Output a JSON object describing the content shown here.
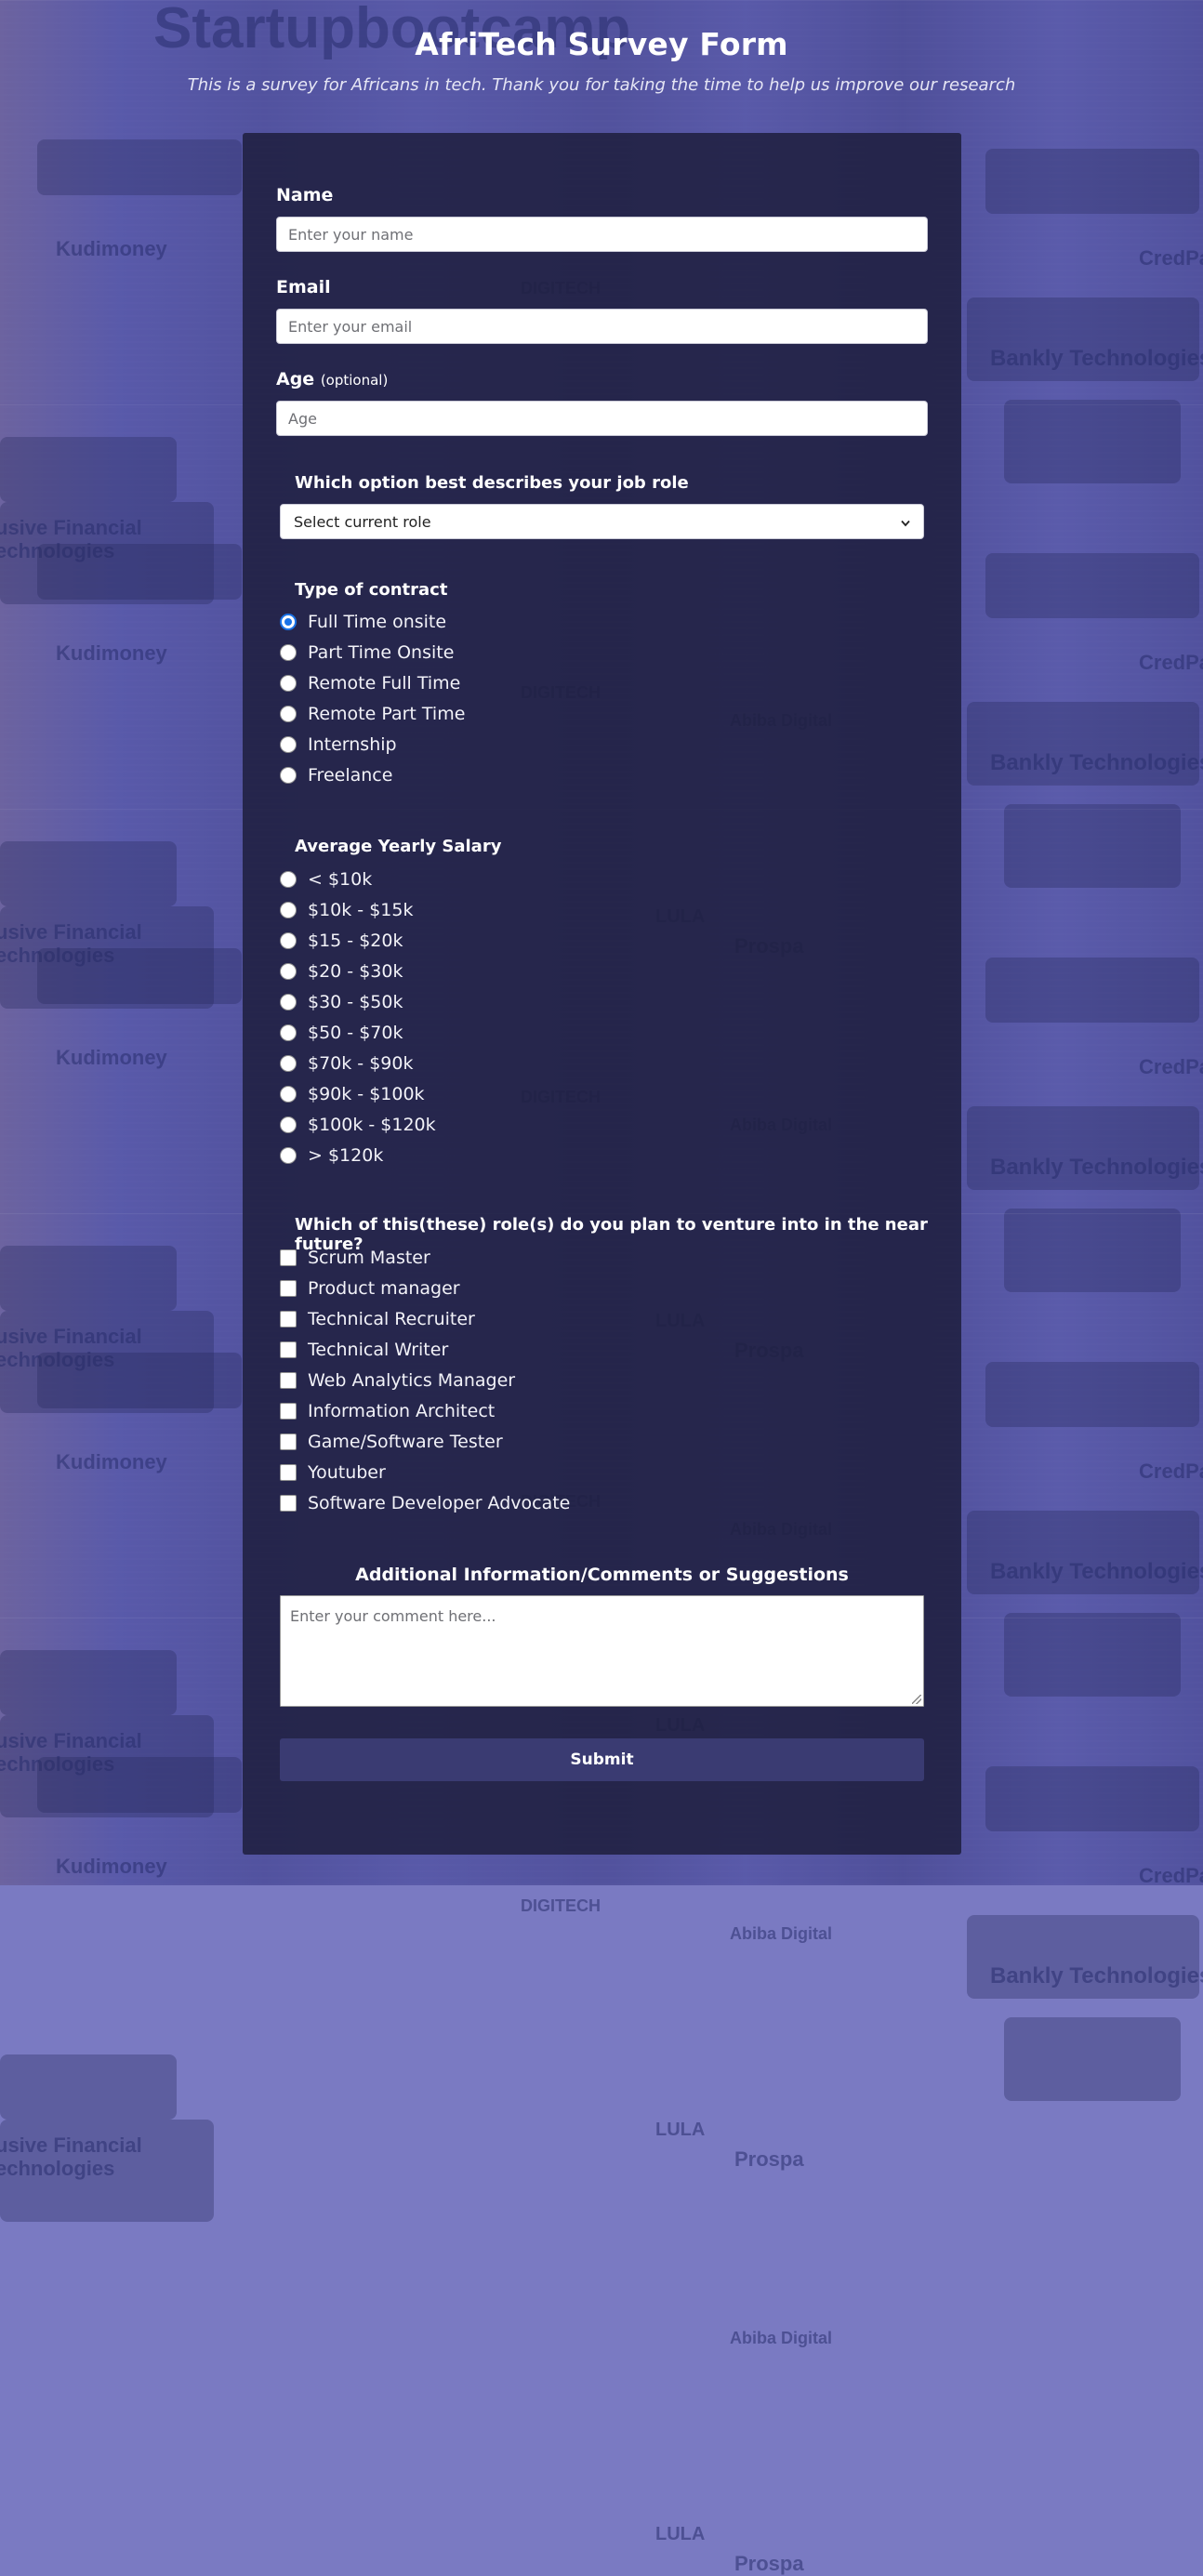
{
  "header": {
    "title": "AfriTech Survey Form",
    "subtitle": "This is a survey for Africans in tech. Thank you for taking the time to help us improve our research"
  },
  "background": {
    "signs": [
      "Startupbootcamp",
      "Kudimoney",
      "CredPal",
      "Bankly Technologies",
      "DIGITECH",
      "Abiba Digital",
      "LULA",
      "Prospa",
      "usive Financial",
      "echnologies"
    ]
  },
  "form": {
    "name": {
      "label": "Name",
      "placeholder": "Enter your name",
      "value": ""
    },
    "email": {
      "label": "Email",
      "placeholder": "Enter your email",
      "value": ""
    },
    "age": {
      "label": "Age",
      "label_note": "(optional)",
      "placeholder": "Age",
      "value": ""
    },
    "role": {
      "label": "Which option best describes your job role",
      "selected": "Select current role"
    },
    "contract": {
      "label": "Type of contract",
      "options": [
        "Full Time onsite",
        "Part Time Onsite",
        "Remote Full Time",
        "Remote Part Time",
        "Internship",
        "Freelance"
      ],
      "selected": "Full Time onsite"
    },
    "salary": {
      "label": "Average Yearly Salary",
      "options": [
        "< $10k",
        "$10k - $15k",
        "$15 - $20k",
        "$20 - $30k",
        "$30 - $50k",
        "$50 - $70k",
        "$70k - $90k",
        "$90k - $100k",
        "$100k - $120k",
        "> $120k"
      ],
      "selected": null
    },
    "future_roles": {
      "label": "Which of this(these) role(s) do you plan to venture into in the near future?",
      "options": [
        "Scrum Master",
        "Product manager",
        "Technical Recruiter",
        "Technical Writer",
        "Web Analytics Manager",
        "Information Architect",
        "Game/Software Tester",
        "Youtuber",
        "Software Developer Advocate"
      ],
      "checked": []
    },
    "comments": {
      "label": "Additional Information/Comments or Suggestions",
      "placeholder": "Enter your comment here..."
    },
    "submit_label": "Submit"
  },
  "colors": {
    "background": "#5858aa",
    "panel": "#1e1e3e",
    "submit": "#3a3b72",
    "radio_checked": "#1a73e8"
  }
}
